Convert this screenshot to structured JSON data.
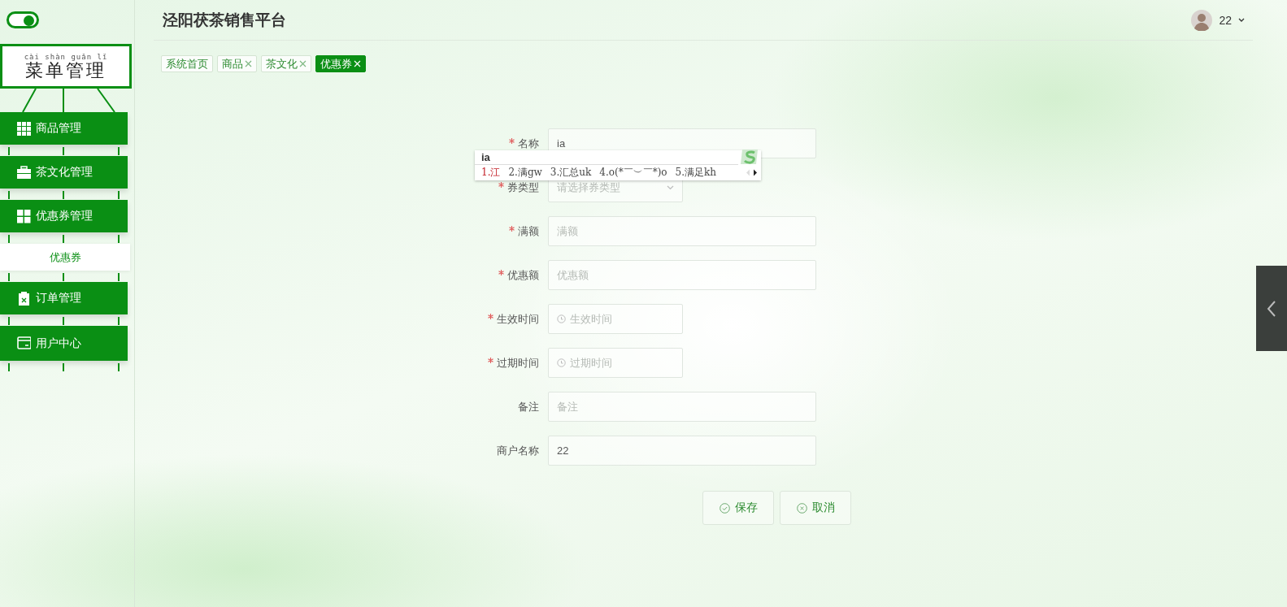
{
  "sidebar": {
    "toggle": {
      "on": true
    },
    "title": {
      "text": "菜单管理",
      "pinyin": "cài shàn guǎn lǐ"
    },
    "menu": [
      {
        "label": "商品管理",
        "kind": "group"
      },
      {
        "label": "茶文化管理",
        "kind": "group"
      },
      {
        "label": "优惠券管理",
        "kind": "group"
      },
      {
        "label": "优惠券",
        "kind": "item"
      },
      {
        "label": "订单管理",
        "kind": "group"
      },
      {
        "label": "用户中心",
        "kind": "group"
      }
    ]
  },
  "header": {
    "title": "泾阳茯茶销售平台",
    "user": {
      "name": "22"
    }
  },
  "tabs": [
    {
      "label": "系统首页",
      "selected": false,
      "closable": false
    },
    {
      "label": "商品",
      "selected": false,
      "closable": true
    },
    {
      "label": "茶文化",
      "selected": false,
      "closable": true
    },
    {
      "label": "优惠券",
      "selected": true,
      "closable": true
    }
  ],
  "form": {
    "fields": [
      {
        "label": "名称",
        "required": true,
        "kind": "text",
        "value": "ia"
      },
      {
        "label": "券类型",
        "required": true,
        "kind": "select",
        "placeholder": "请选择券类型"
      },
      {
        "label": "满额",
        "required": true,
        "kind": "text",
        "placeholder": "满额"
      },
      {
        "label": "优惠额",
        "required": true,
        "kind": "text",
        "placeholder": "优惠额"
      },
      {
        "label": "生效时间",
        "required": true,
        "kind": "date",
        "placeholder": "生效时间"
      },
      {
        "label": "过期时间",
        "required": true,
        "kind": "date",
        "placeholder": "过期时间"
      },
      {
        "label": "备注",
        "required": false,
        "kind": "text",
        "placeholder": "备注"
      },
      {
        "label": "商户名称",
        "required": false,
        "kind": "text",
        "value": "22"
      }
    ],
    "buttons": [
      {
        "label": "保存",
        "kind": "save"
      },
      {
        "label": "取消",
        "kind": "cancel"
      }
    ]
  },
  "ime": {
    "composition": "ia",
    "candidates": [
      {
        "text": "1.江",
        "selected": true
      },
      {
        "text": "2.满gw",
        "selected": false
      },
      {
        "text": "3.汇总uk",
        "selected": false
      },
      {
        "text": "4.o(*￣︶￣*)o",
        "selected": false
      },
      {
        "text": "5.满足kh",
        "selected": false
      }
    ]
  }
}
